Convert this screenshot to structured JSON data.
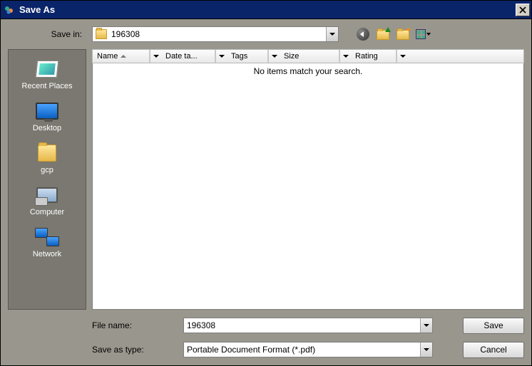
{
  "title": "Save As",
  "save_in_label": "Save in:",
  "save_in_value": "196308",
  "places": [
    {
      "label": "Recent Places",
      "icon": "recent"
    },
    {
      "label": "Desktop",
      "icon": "desktop"
    },
    {
      "label": "gcp",
      "icon": "folder"
    },
    {
      "label": "Computer",
      "icon": "computer"
    },
    {
      "label": "Network",
      "icon": "network"
    }
  ],
  "columns": {
    "name": "Name",
    "date": "Date ta...",
    "tags": "Tags",
    "size": "Size",
    "rating": "Rating"
  },
  "empty_message": "No items match your search.",
  "file_name_label": "File name:",
  "file_name_value": "196308",
  "save_type_label": "Save as type:",
  "save_type_value": "Portable Document Format (*.pdf)",
  "buttons": {
    "save": "Save",
    "cancel": "Cancel"
  }
}
